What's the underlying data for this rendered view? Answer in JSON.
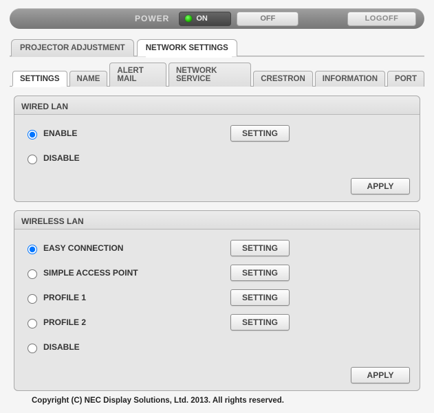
{
  "topbar": {
    "power_label": "POWER",
    "on_label": "ON",
    "off_label": "OFF",
    "logoff_label": "LOGOFF"
  },
  "main_tabs": {
    "projector_adjustment": "PROJECTOR ADJUSTMENT",
    "network_settings": "NETWORK SETTINGS",
    "active": "network_settings"
  },
  "sub_tabs": {
    "settings": "SETTINGS",
    "name": "NAME",
    "alert_mail": "ALERT MAIL",
    "network_service": "NETWORK SERVICE",
    "crestron": "CRESTRON",
    "information": "INFORMATION",
    "port": "PORT",
    "active": "settings"
  },
  "wired_lan": {
    "title": "WIRED LAN",
    "options": {
      "enable": "ENABLE",
      "disable": "DISABLE"
    },
    "selected": "enable",
    "setting_btn": "SETTING",
    "apply_btn": "APPLY"
  },
  "wireless_lan": {
    "title": "WIRELESS LAN",
    "options": {
      "easy_connection": "EASY CONNECTION",
      "simple_access_point": "SIMPLE ACCESS POINT",
      "profile1": "PROFILE 1",
      "profile2": "PROFILE 2",
      "disable": "DISABLE"
    },
    "selected": "easy_connection",
    "setting_btn": "SETTING",
    "apply_btn": "APPLY"
  },
  "footer": {
    "copyright": "Copyright (C) NEC Display Solutions, Ltd. 2013. All rights reserved."
  }
}
